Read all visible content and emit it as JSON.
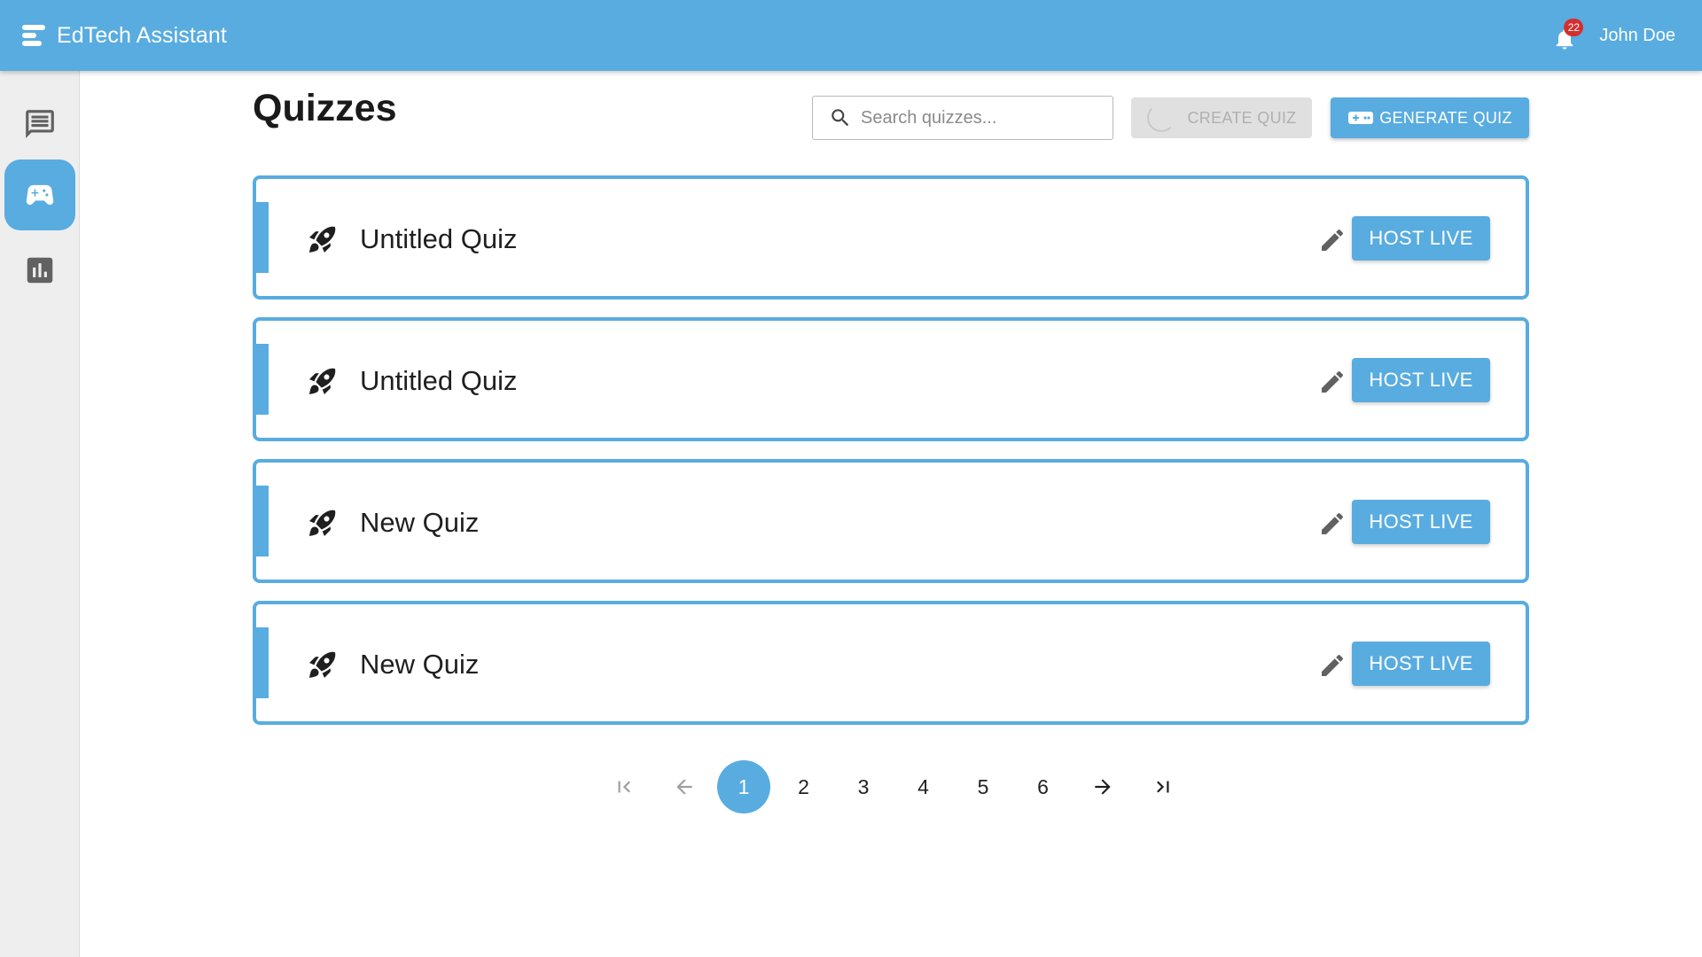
{
  "app": {
    "title": "EdTech Assistant",
    "notification_count": "22",
    "user_name": "John Doe"
  },
  "sidebar": {
    "items": [
      {
        "icon": "chat-icon",
        "active": false
      },
      {
        "icon": "gamepad-icon",
        "active": true
      },
      {
        "icon": "bar-chart-icon",
        "active": false
      }
    ]
  },
  "page": {
    "title": "Quizzes"
  },
  "toolbar": {
    "search_placeholder": "Search quizzes...",
    "create_label": "CREATE QUIZ",
    "create_state": "loading",
    "generate_label": "GENERATE QUIZ"
  },
  "quizzes": [
    {
      "title": "Untitled Quiz",
      "action_label": "HOST LIVE",
      "icon": "rocket-icon"
    },
    {
      "title": "Untitled Quiz",
      "action_label": "HOST LIVE",
      "icon": "rocket-icon"
    },
    {
      "title": "New Quiz",
      "action_label": "HOST LIVE",
      "icon": "rocket-icon"
    },
    {
      "title": "New Quiz",
      "action_label": "HOST LIVE",
      "icon": "rocket-icon"
    }
  ],
  "pagination": {
    "current": "1",
    "pages": [
      "1",
      "2",
      "3",
      "4",
      "5",
      "6"
    ]
  },
  "colors": {
    "primary": "#58ace0",
    "sidebar_bg": "#eeeeee",
    "badge": "#d32f2f",
    "disabled_bg": "#e0e0e0"
  }
}
